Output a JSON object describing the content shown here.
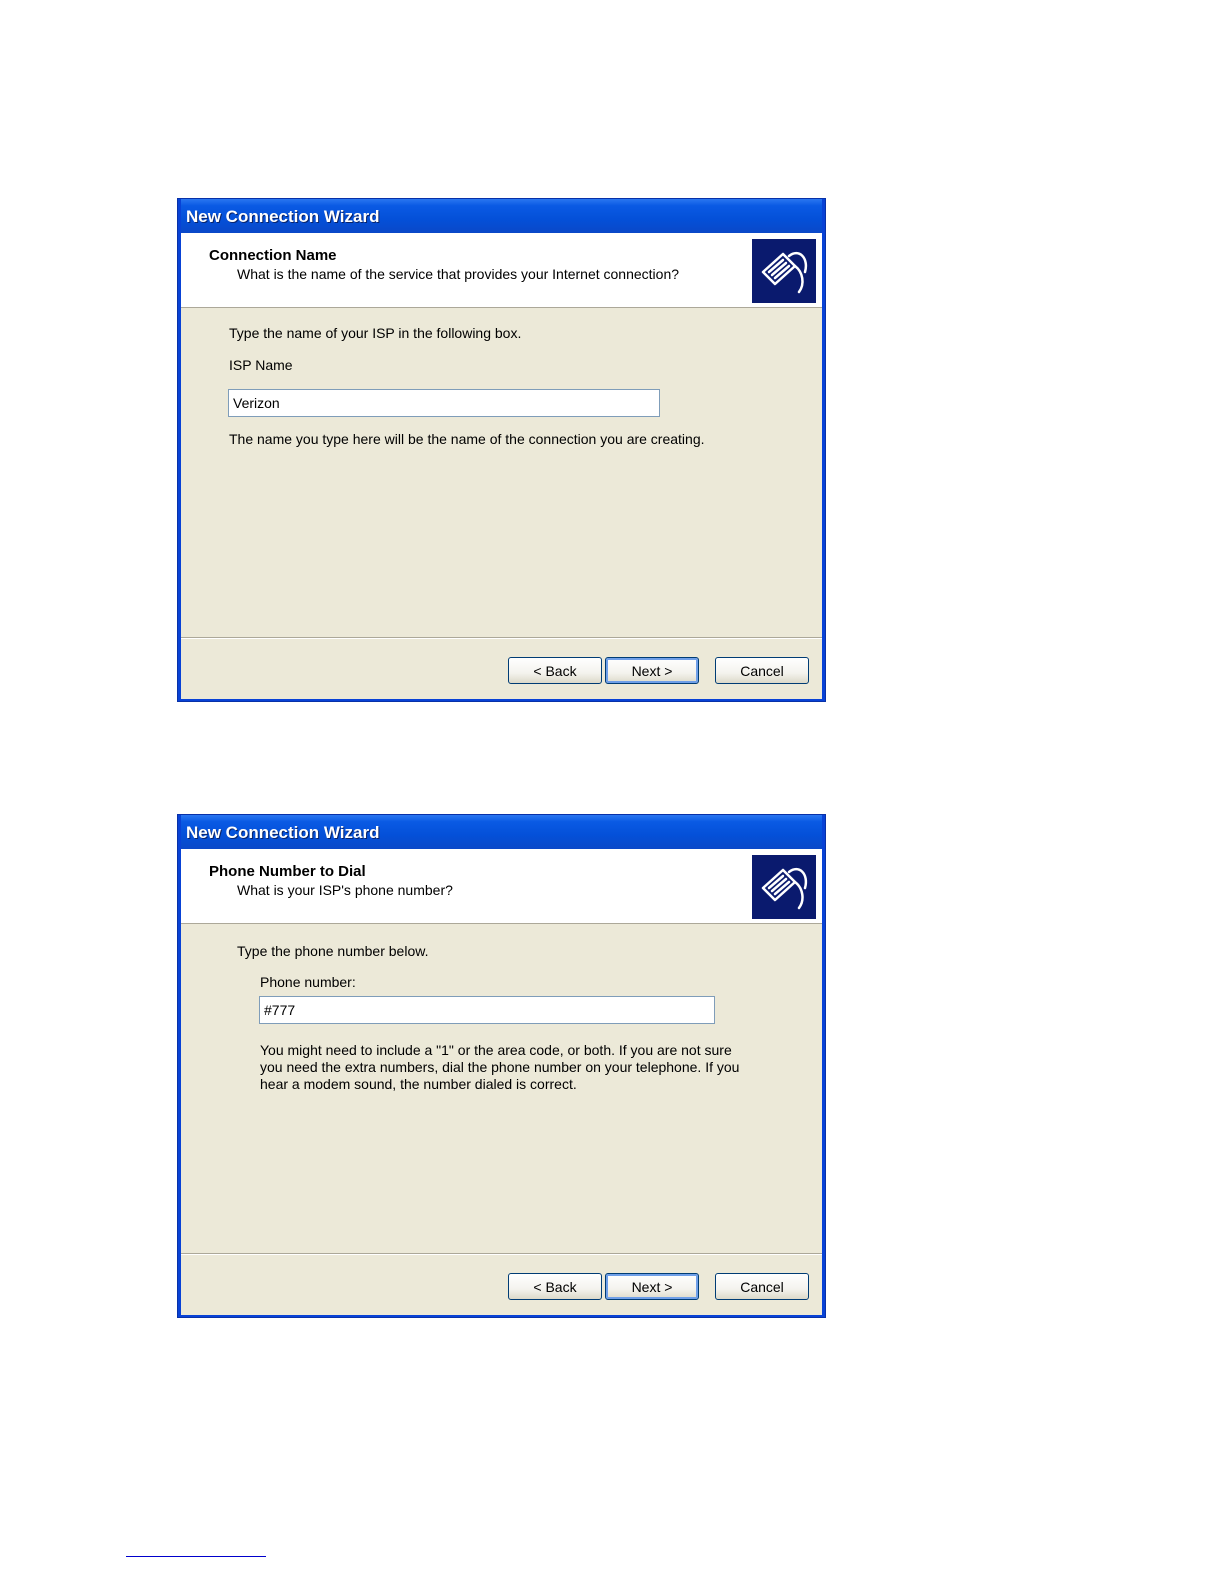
{
  "wizards": [
    {
      "title": "New Connection Wizard",
      "header_title": "Connection Name",
      "header_subtitle": "What is the name of the service that provides your Internet connection?",
      "instruction": "Type the name of your ISP in the following box.",
      "field_label": "ISP Name",
      "field_value": "Verizon",
      "help_text": "The name you type here will be the name of the connection you are creating.",
      "buttons": {
        "back": "< Back",
        "next": "Next >",
        "cancel": "Cancel"
      }
    },
    {
      "title": "New Connection Wizard",
      "header_title": "Phone Number to Dial",
      "header_subtitle": "What is your ISP's phone number?",
      "instruction": "Type the phone number below.",
      "field_label": "Phone number:",
      "field_value": "#777",
      "help_lines": [
        "You might need to include a \"1\" or the area code, or both. If you are not sure",
        "you need the extra numbers, dial the phone number on your telephone. If you",
        "hear a modem sound, the number dialed is correct."
      ],
      "buttons": {
        "back": "< Back",
        "next": "Next >",
        "cancel": "Cancel"
      }
    }
  ],
  "icons": {
    "header_icon": "network-cable-icon"
  }
}
